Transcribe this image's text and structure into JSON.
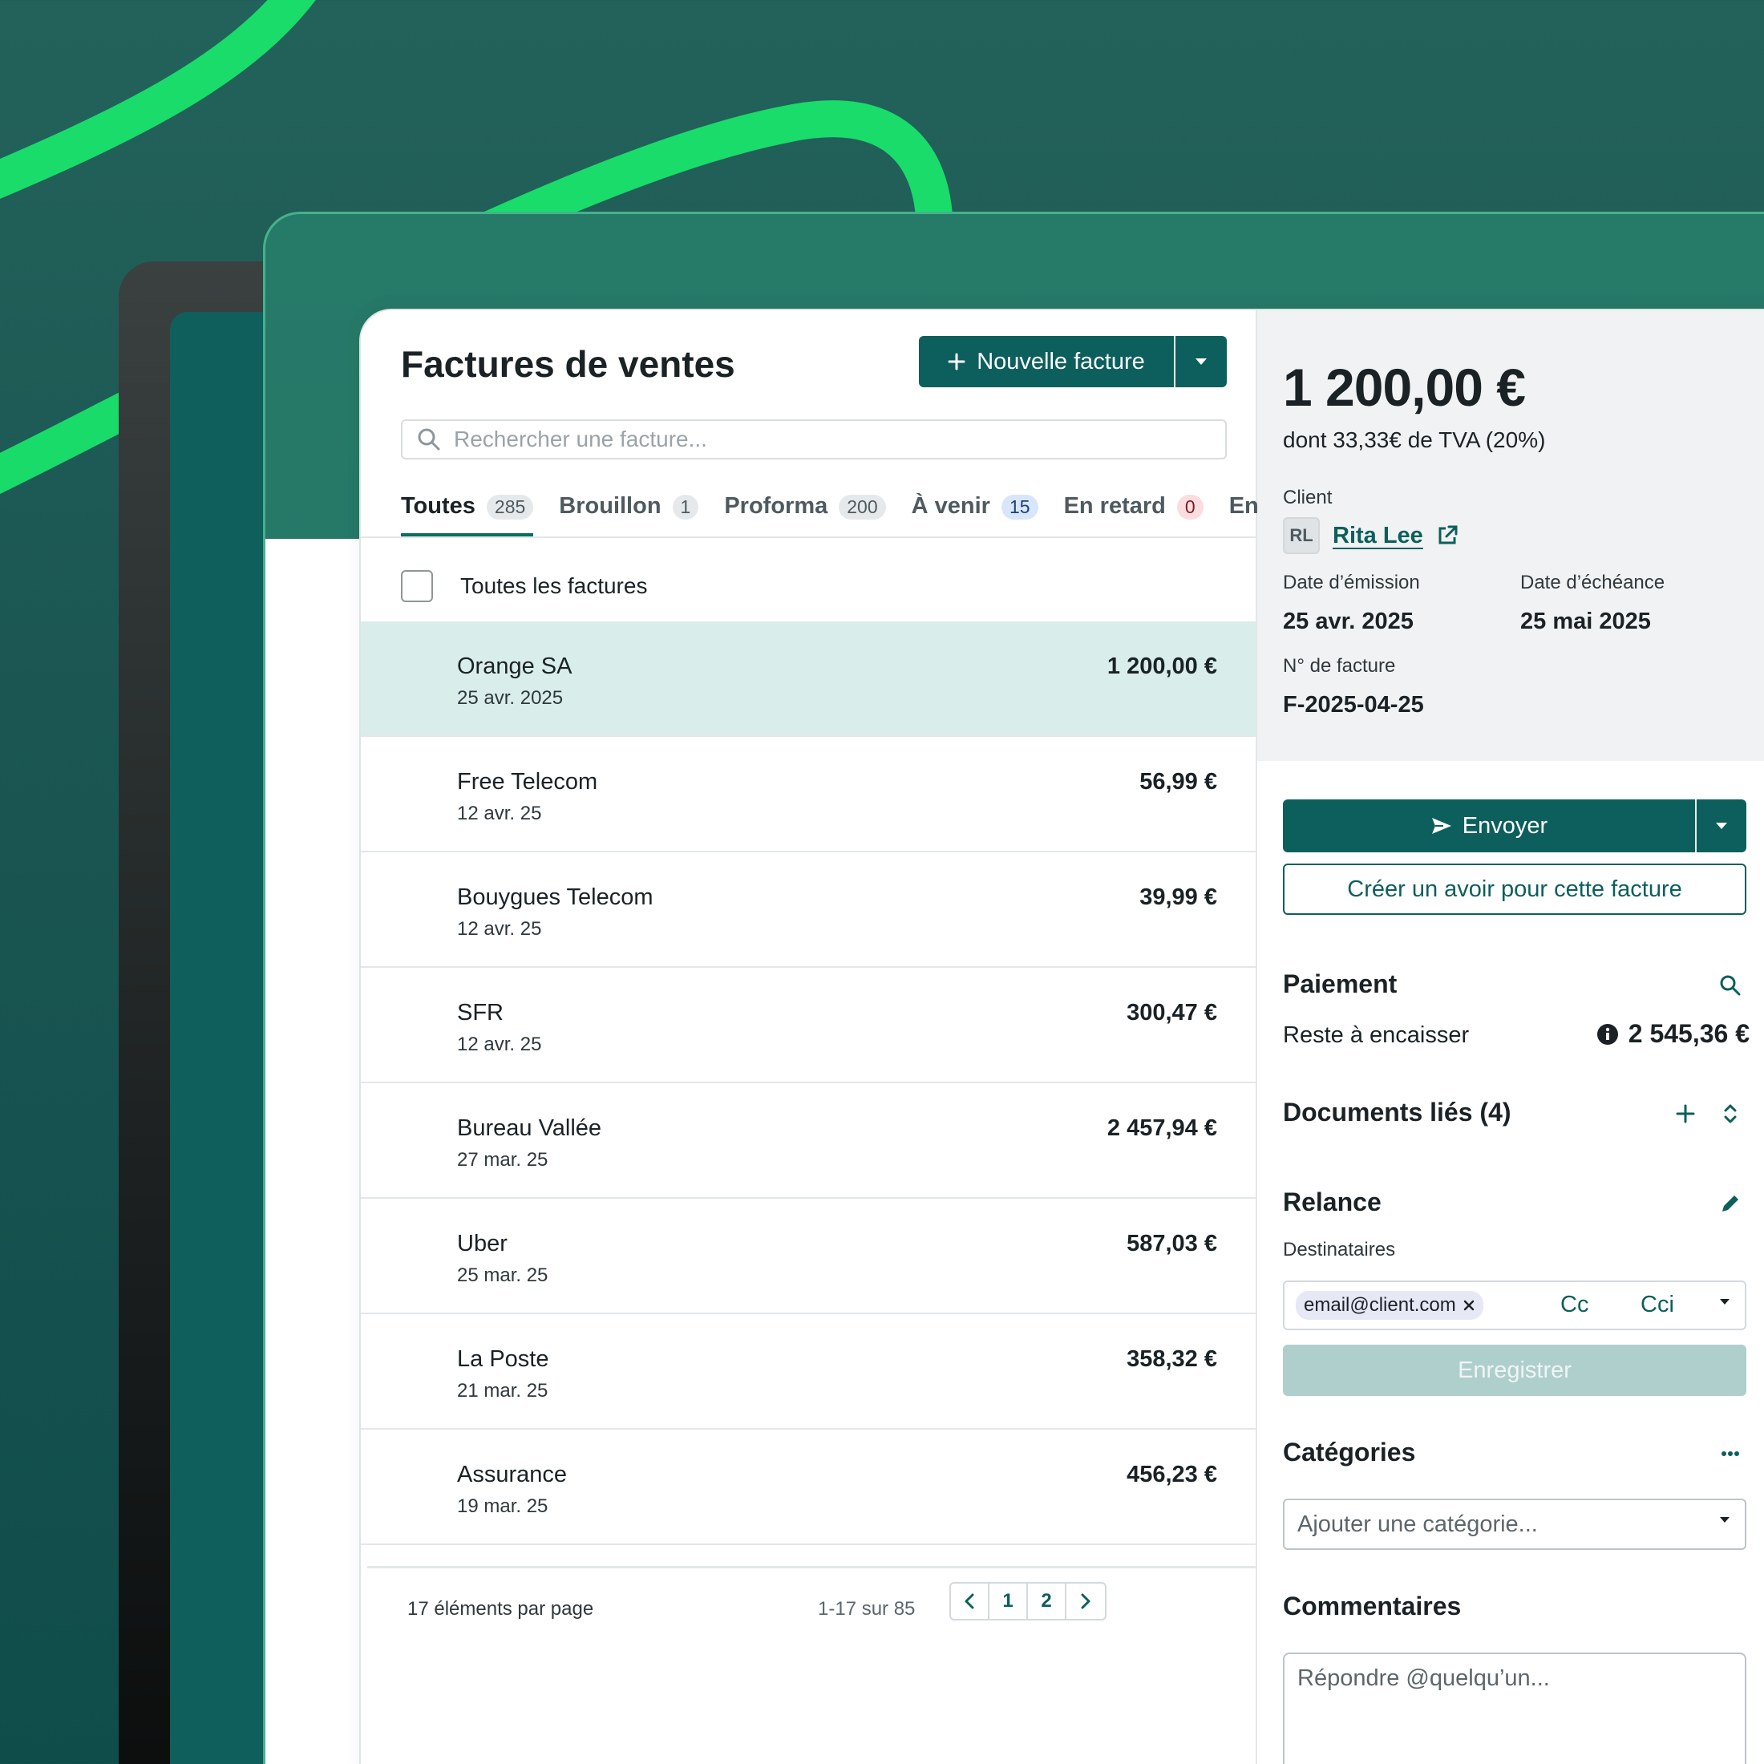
{
  "list": {
    "title": "Factures de ventes",
    "new_button_label": "Nouvelle facture",
    "search_placeholder": "Rechercher une facture...",
    "tabs": [
      {
        "label": "Toutes",
        "count": "285"
      },
      {
        "label": "Brouillon",
        "count": "1"
      },
      {
        "label": "Proforma",
        "count": "200"
      },
      {
        "label": "À venir",
        "count": "15"
      },
      {
        "label": "En retard",
        "count": "0"
      },
      {
        "label": "En"
      }
    ],
    "select_all_label": "Toutes les factures",
    "rows": [
      {
        "name": "Orange SA",
        "date": "25 avr. 2025",
        "amount": "1 200,00 €"
      },
      {
        "name": "Free Telecom",
        "date": "12 avr. 25",
        "amount": "56,99 €"
      },
      {
        "name": "Bouygues Telecom",
        "date": "12 avr. 25",
        "amount": "39,99 €"
      },
      {
        "name": "SFR",
        "date": "12 avr. 25",
        "amount": "300,47 €"
      },
      {
        "name": "Bureau Vallée",
        "date": "27 mar. 25",
        "amount": "2 457,94 €"
      },
      {
        "name": "Uber",
        "date": "25 mar. 25",
        "amount": "587,03 €"
      },
      {
        "name": "La Poste",
        "date": "21 mar. 25",
        "amount": "358,32 €"
      },
      {
        "name": "Assurance",
        "date": "19 mar. 25",
        "amount": "456,23 €"
      }
    ],
    "footer": {
      "per_page": "17 éléments par page",
      "range": "1-17 sur 85",
      "pages": [
        "1",
        "2"
      ]
    }
  },
  "detail": {
    "total": "1 200,00 €",
    "vat": "dont 33,33€ de TVA (20%)",
    "client_label": "Client",
    "client_initials": "RL",
    "client_name": "Rita Lee",
    "issue_date_label": "Date d’émission",
    "issue_date": "25 avr. 2025",
    "due_date_label": "Date d’échéance",
    "due_date": "25 mai 2025",
    "invoice_number_label": "N° de facture",
    "invoice_number": "F-2025-04-25",
    "send_label": "Envoyer",
    "credit_label": "Créer un avoir pour cette facture",
    "payment_title": "Paiement",
    "remaining_label": "Reste à encaisser",
    "remaining_amount": "2 545,36 €",
    "linked_docs_title": "Documents liés (4)",
    "reminder_title": "Relance",
    "recipients_label": "Destinataires",
    "recipient_email": "email@client.com",
    "cc_label": "Cc",
    "cci_label": "Cci",
    "save_label": "Enregistrer",
    "categories_title": "Catégories",
    "category_placeholder": "Ajouter une catégorie...",
    "comments_title": "Commentaires",
    "comment_placeholder": "Répondre @quelqu’un..."
  },
  "colors": {
    "brand": "#0c5f5c",
    "selected_row": "#d9eeea",
    "accent_green": "#19e36b",
    "background": "#1b5652"
  }
}
